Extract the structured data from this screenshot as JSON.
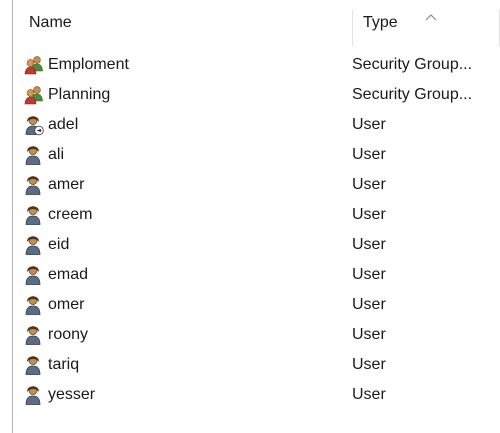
{
  "header": {
    "name_label": "Name",
    "type_label": "Type",
    "sort_indicator": "sort-ascending-caret"
  },
  "rows": [
    {
      "icon": "group-icon",
      "name": "Emploment",
      "type": "Security Group..."
    },
    {
      "icon": "group-icon",
      "name": "Planning",
      "type": "Security Group..."
    },
    {
      "icon": "user-disabled-icon",
      "name": "adel",
      "type": "User"
    },
    {
      "icon": "user-icon",
      "name": "ali",
      "type": "User"
    },
    {
      "icon": "user-icon",
      "name": "amer",
      "type": "User"
    },
    {
      "icon": "user-icon",
      "name": "creem",
      "type": "User"
    },
    {
      "icon": "user-icon",
      "name": "eid",
      "type": "User"
    },
    {
      "icon": "user-icon",
      "name": "emad",
      "type": "User"
    },
    {
      "icon": "user-icon",
      "name": "omer",
      "type": "User"
    },
    {
      "icon": "user-icon",
      "name": "roony",
      "type": "User"
    },
    {
      "icon": "user-icon",
      "name": "tariq",
      "type": "User"
    },
    {
      "icon": "user-icon",
      "name": "yesser",
      "type": "User"
    }
  ]
}
